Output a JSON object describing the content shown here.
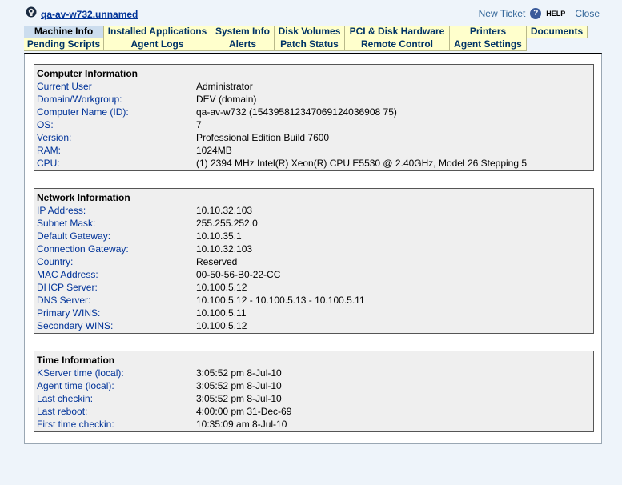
{
  "header": {
    "agent_name": "qa-av-w732.unnamed",
    "new_ticket": "New Ticket",
    "help_icon": "question-circle-icon",
    "help": "HELP",
    "close": "Close"
  },
  "tabs": {
    "row1": [
      "Machine Info",
      "Installed Applications",
      "System Info",
      "Disk Volumes",
      "PCI & Disk Hardware",
      "Printers",
      "Documents"
    ],
    "row2": [
      "Pending Scripts",
      "Agent Logs",
      "Alerts",
      "Patch Status",
      "Remote Control",
      "Agent Settings"
    ]
  },
  "computer": {
    "title": "Computer Information",
    "rows": [
      {
        "label": "Current User",
        "value": "Administrator"
      },
      {
        "label": "Domain/Workgroup:",
        "value": "DEV (domain)"
      },
      {
        "label": "Computer Name (ID):",
        "value": "qa-av-w732  (154395812347069124036908 75)"
      },
      {
        "label": "OS:",
        "value": "7"
      },
      {
        "label": "Version:",
        "value": "Professional Edition Build 7600"
      },
      {
        "label": "RAM:",
        "value": "1024MB"
      },
      {
        "label": "CPU:",
        "value": "(1) 2394 MHz Intel(R) Xeon(R) CPU E5530 @ 2.40GHz, Model 26 Stepping 5"
      }
    ]
  },
  "network": {
    "title": "Network Information",
    "rows": [
      {
        "label": "IP Address:",
        "value": "10.10.32.103"
      },
      {
        "label": "Subnet Mask:",
        "value": "255.255.252.0"
      },
      {
        "label": "Default Gateway:",
        "value": "10.10.35.1"
      },
      {
        "label": "Connection Gateway:",
        "value": "10.10.32.103"
      },
      {
        "label": "Country:",
        "value": "Reserved"
      },
      {
        "label": "MAC Address:",
        "value": "00-50-56-B0-22-CC"
      },
      {
        "label": "DHCP Server:",
        "value": "10.100.5.12"
      },
      {
        "label": "DNS Server:",
        "value": "10.100.5.12 - 10.100.5.13 - 10.100.5.11"
      },
      {
        "label": "Primary WINS:",
        "value": "10.100.5.11"
      },
      {
        "label": "Secondary WINS:",
        "value": "10.100.5.12"
      }
    ]
  },
  "time": {
    "title": "Time Information",
    "rows": [
      {
        "label": "KServer time (local):",
        "value": "3:05:52 pm 8-Jul-10"
      },
      {
        "label": "Agent time (local):",
        "value": "3:05:52 pm 8-Jul-10"
      },
      {
        "label": "Last checkin:",
        "value": "3:05:52 pm 8-Jul-10"
      },
      {
        "label": "Last reboot:",
        "value": "4:00:00 pm 31-Dec-69"
      },
      {
        "label": "First time checkin:",
        "value": "10:35:09 am 8-Jul-10"
      }
    ]
  }
}
